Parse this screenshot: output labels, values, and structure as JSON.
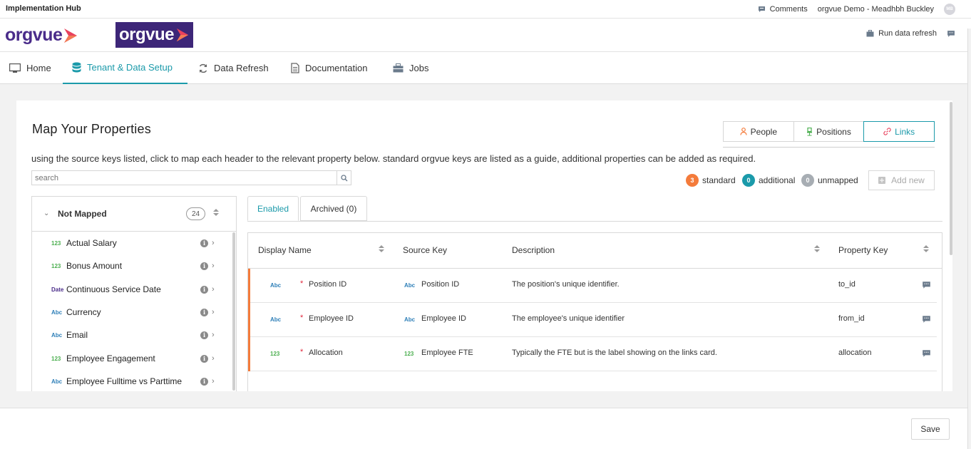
{
  "app": {
    "title": "Implementation Hub",
    "comments_label": "Comments",
    "tenant_user": "orgvue Demo - Meadhbh Buckley",
    "avatar_initials": "MB"
  },
  "logos": {
    "primary": "orgvue",
    "secondary": "orgvue",
    "run_refresh_label": "Run data refresh"
  },
  "nav": {
    "items": [
      {
        "label": "Home",
        "icon": "monitor-icon"
      },
      {
        "label": "Tenant & Data Setup",
        "icon": "database-icon",
        "active": true
      },
      {
        "label": "Data Refresh",
        "icon": "refresh-icon"
      },
      {
        "label": "Documentation",
        "icon": "document-icon"
      },
      {
        "label": "Jobs",
        "icon": "briefcase-icon"
      }
    ]
  },
  "page": {
    "title": "Map Your Properties",
    "instructions": "using the source keys listed, click to map each header to the relevant property below. standard orgvue keys are listed as a guide, additional properties can be added as required.",
    "toggles": [
      {
        "label": "People",
        "icon": "person-icon"
      },
      {
        "label": "Positions",
        "icon": "chair-icon"
      },
      {
        "label": "Links",
        "icon": "link-icon",
        "active": true
      }
    ],
    "search_placeholder": "search",
    "legend": [
      {
        "count": "3",
        "label": "standard",
        "color": "#f47b3b"
      },
      {
        "count": "0",
        "label": "additional",
        "color": "#1b9aaa"
      },
      {
        "count": "0",
        "label": "unmapped",
        "color": "#a7adb3"
      }
    ],
    "add_new_label": "Add new",
    "save_label": "Save"
  },
  "not_mapped": {
    "title": "Not Mapped",
    "count": "24",
    "items": [
      {
        "type": "123",
        "label": "Actual Salary"
      },
      {
        "type": "123",
        "label": "Bonus Amount"
      },
      {
        "type": "Date",
        "label": "Continuous Service Date"
      },
      {
        "type": "Abc",
        "label": "Currency"
      },
      {
        "type": "Abc",
        "label": "Email"
      },
      {
        "type": "123",
        "label": "Employee Engagement"
      },
      {
        "type": "Abc",
        "label": "Employee Fulltime vs Parttime"
      }
    ]
  },
  "mapping": {
    "tabs": [
      "Enabled",
      "Archived (0)"
    ],
    "columns": [
      "Display Name",
      "Source Key",
      "Description",
      "Property Key"
    ],
    "rows": [
      {
        "display_type": "Abc",
        "display_name": "Position ID",
        "source_type": "Abc",
        "source_key": "Position ID",
        "description": "The position's unique identifier.",
        "property_key": "to_id"
      },
      {
        "display_type": "Abc",
        "display_name": "Employee ID",
        "source_type": "Abc",
        "source_key": "Employee ID",
        "description": "The employee's unique identifier",
        "property_key": "from_id"
      },
      {
        "display_type": "123",
        "display_name": "Allocation",
        "source_type": "123",
        "source_key": "Employee FTE",
        "description": "Typically the FTE but is the label showing on the links card.",
        "property_key": "allocation"
      }
    ]
  }
}
